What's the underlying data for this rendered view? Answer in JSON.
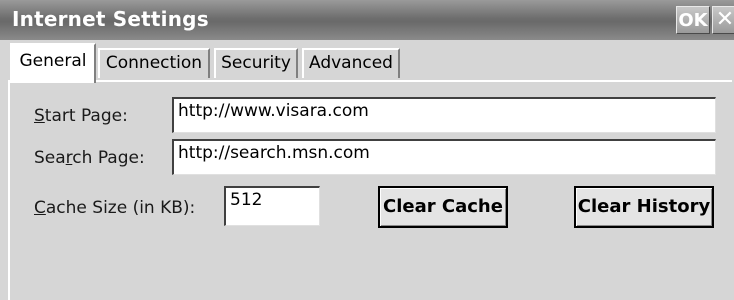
{
  "window": {
    "title": "Internet Settings",
    "ok_label": "OK",
    "close_label": "✕"
  },
  "tabs": [
    {
      "label": "General",
      "active": true
    },
    {
      "label": "Connection",
      "active": false
    },
    {
      "label": "Security",
      "active": false
    },
    {
      "label": "Advanced",
      "active": false
    }
  ],
  "general": {
    "start_page": {
      "label_pre": "",
      "label_accel": "S",
      "label_post": "tart Page:",
      "value": "http://www.visara.com"
    },
    "search_page": {
      "label_pre": "Sea",
      "label_accel": "r",
      "label_post": "ch Page:",
      "value": "http://search.msn.com"
    },
    "cache_size": {
      "label_pre": "",
      "label_accel": "C",
      "label_post": "ache Size (in KB):",
      "value": "512"
    },
    "clear_cache_label": "Clear Cache",
    "clear_history_label": "Clear History"
  },
  "colors": {
    "titlebar": "#6e6e6e",
    "panel_bg": "#d6d6d6",
    "field_bg": "#ffffff"
  }
}
